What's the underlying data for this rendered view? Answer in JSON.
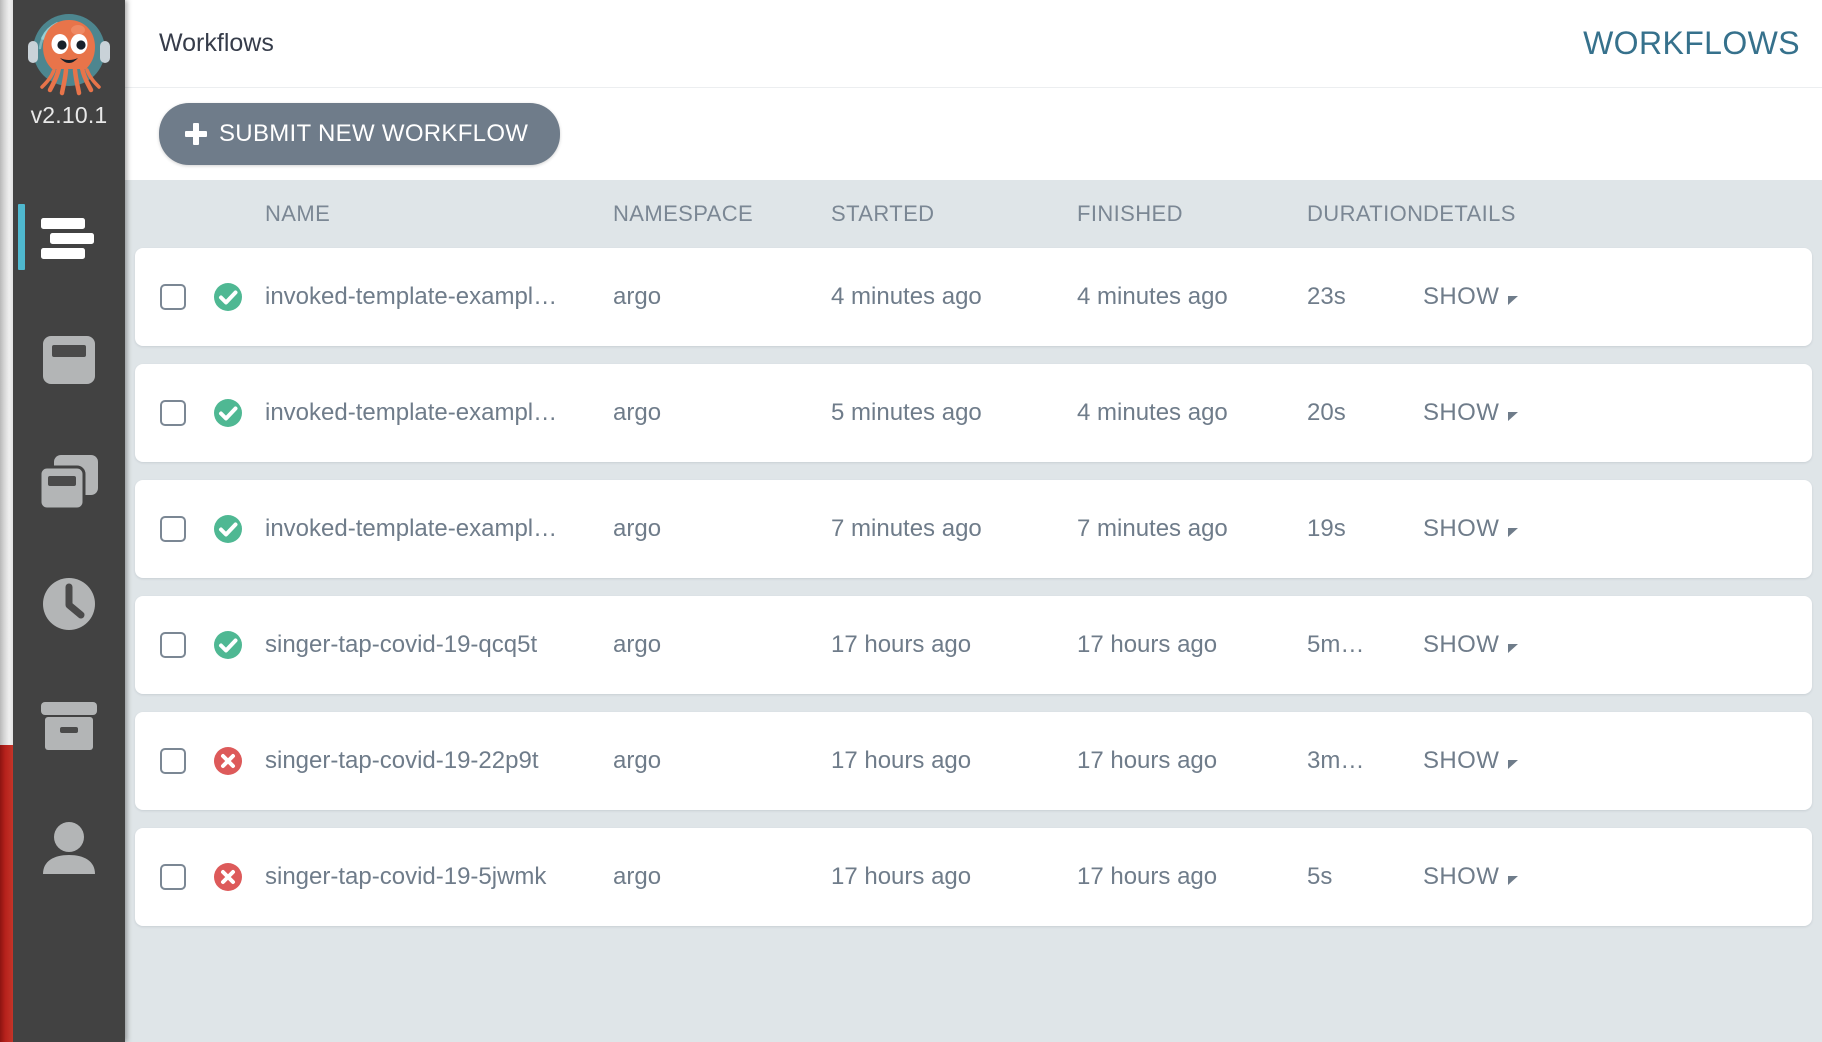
{
  "sidebar": {
    "version": "v2.10.1",
    "logo_alt": "argo-octopus-logo",
    "items": [
      {
        "name": "workflows",
        "icon": "list-lines-icon",
        "active": true
      },
      {
        "name": "workflow-template",
        "icon": "window-icon",
        "active": false
      },
      {
        "name": "cluster-templates",
        "icon": "copy-windows-icon",
        "active": false
      },
      {
        "name": "cron-workflows",
        "icon": "clock-icon",
        "active": false
      },
      {
        "name": "archived",
        "icon": "archive-box-icon",
        "active": false
      },
      {
        "name": "user",
        "icon": "user-icon",
        "active": false
      }
    ]
  },
  "topbar": {
    "title": "Workflows",
    "right_title": "WORKFLOWS"
  },
  "actionbar": {
    "submit_label": "SUBMIT NEW WORKFLOW"
  },
  "table": {
    "columns": {
      "name": "NAME",
      "namespace": "NAMESPACE",
      "started": "STARTED",
      "finished": "FINISHED",
      "duration": "DURATION",
      "details": "DETAILS"
    },
    "details_label": "SHOW",
    "rows": [
      {
        "status": "succeeded",
        "name": "invoked-template-exampl…",
        "namespace": "argo",
        "started": "4 minutes ago",
        "finished": "4 minutes ago",
        "duration": "23s",
        "details": "SHOW"
      },
      {
        "status": "succeeded",
        "name": "invoked-template-exampl…",
        "namespace": "argo",
        "started": "5 minutes ago",
        "finished": "4 minutes ago",
        "duration": "20s",
        "details": "SHOW"
      },
      {
        "status": "succeeded",
        "name": "invoked-template-exampl…",
        "namespace": "argo",
        "started": "7 minutes ago",
        "finished": "7 minutes ago",
        "duration": "19s",
        "details": "SHOW"
      },
      {
        "status": "succeeded",
        "name": "singer-tap-covid-19-qcq5t",
        "namespace": "argo",
        "started": "17 hours ago",
        "finished": "17 hours ago",
        "duration": "5m…",
        "details": "SHOW"
      },
      {
        "status": "failed",
        "name": "singer-tap-covid-19-22p9t",
        "namespace": "argo",
        "started": "17 hours ago",
        "finished": "17 hours ago",
        "duration": "3m…",
        "details": "SHOW"
      },
      {
        "status": "failed",
        "name": "singer-tap-covid-19-5jwmk",
        "namespace": "argo",
        "started": "17 hours ago",
        "finished": "17 hours ago",
        "duration": "5s",
        "details": "SHOW"
      }
    ]
  },
  "colors": {
    "success": "#4fb893",
    "failed": "#dd5a5a",
    "accent": "#36718c",
    "active_nav": "#4fb8cf",
    "button": "#6f7c8a",
    "table_bg": "#dfe5e8",
    "sidebar_bg": "#424242",
    "edge_red": "#b5211b"
  }
}
